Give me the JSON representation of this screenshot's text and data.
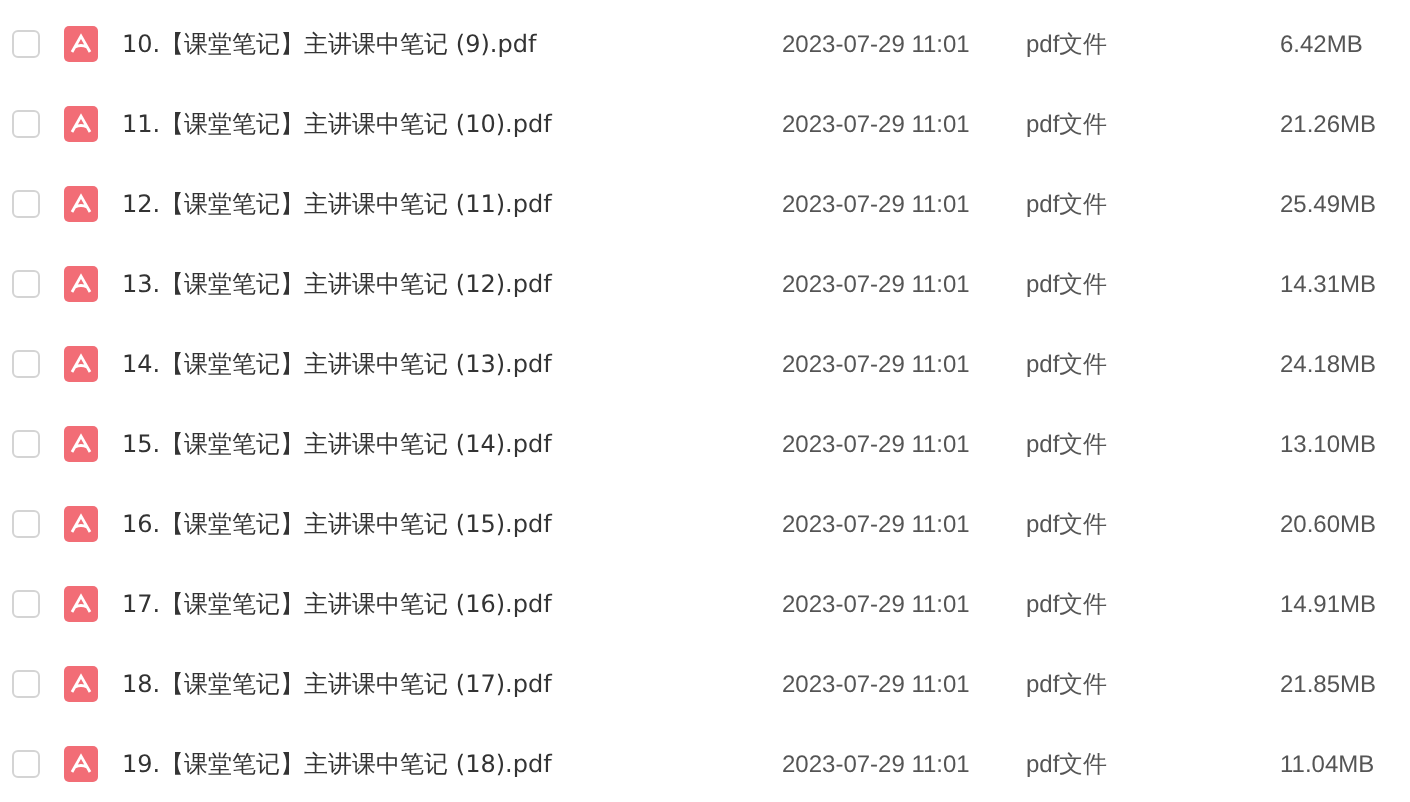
{
  "files": [
    {
      "name": "10.【课堂笔记】主讲课中笔记 (9).pdf",
      "date": "2023-07-29 11:01",
      "type": "pdf文件",
      "size": "6.42MB",
      "checked": false
    },
    {
      "name": "11.【课堂笔记】主讲课中笔记 (10).pdf",
      "date": "2023-07-29 11:01",
      "type": "pdf文件",
      "size": "21.26MB",
      "checked": false
    },
    {
      "name": "12.【课堂笔记】主讲课中笔记 (11).pdf",
      "date": "2023-07-29 11:01",
      "type": "pdf文件",
      "size": "25.49MB",
      "checked": false
    },
    {
      "name": "13.【课堂笔记】主讲课中笔记 (12).pdf",
      "date": "2023-07-29 11:01",
      "type": "pdf文件",
      "size": "14.31MB",
      "checked": false
    },
    {
      "name": "14.【课堂笔记】主讲课中笔记 (13).pdf",
      "date": "2023-07-29 11:01",
      "type": "pdf文件",
      "size": "24.18MB",
      "checked": false
    },
    {
      "name": "15.【课堂笔记】主讲课中笔记 (14).pdf",
      "date": "2023-07-29 11:01",
      "type": "pdf文件",
      "size": "13.10MB",
      "checked": false
    },
    {
      "name": "16.【课堂笔记】主讲课中笔记 (15).pdf",
      "date": "2023-07-29 11:01",
      "type": "pdf文件",
      "size": "20.60MB",
      "checked": false
    },
    {
      "name": "17.【课堂笔记】主讲课中笔记 (16).pdf",
      "date": "2023-07-29 11:01",
      "type": "pdf文件",
      "size": "14.91MB",
      "checked": false
    },
    {
      "name": "18.【课堂笔记】主讲课中笔记 (17).pdf",
      "date": "2023-07-29 11:01",
      "type": "pdf文件",
      "size": "21.85MB",
      "checked": false
    },
    {
      "name": "19.【课堂笔记】主讲课中笔记 (18).pdf",
      "date": "2023-07-29 11:01",
      "type": "pdf文件",
      "size": "11.04MB",
      "checked": false
    }
  ]
}
